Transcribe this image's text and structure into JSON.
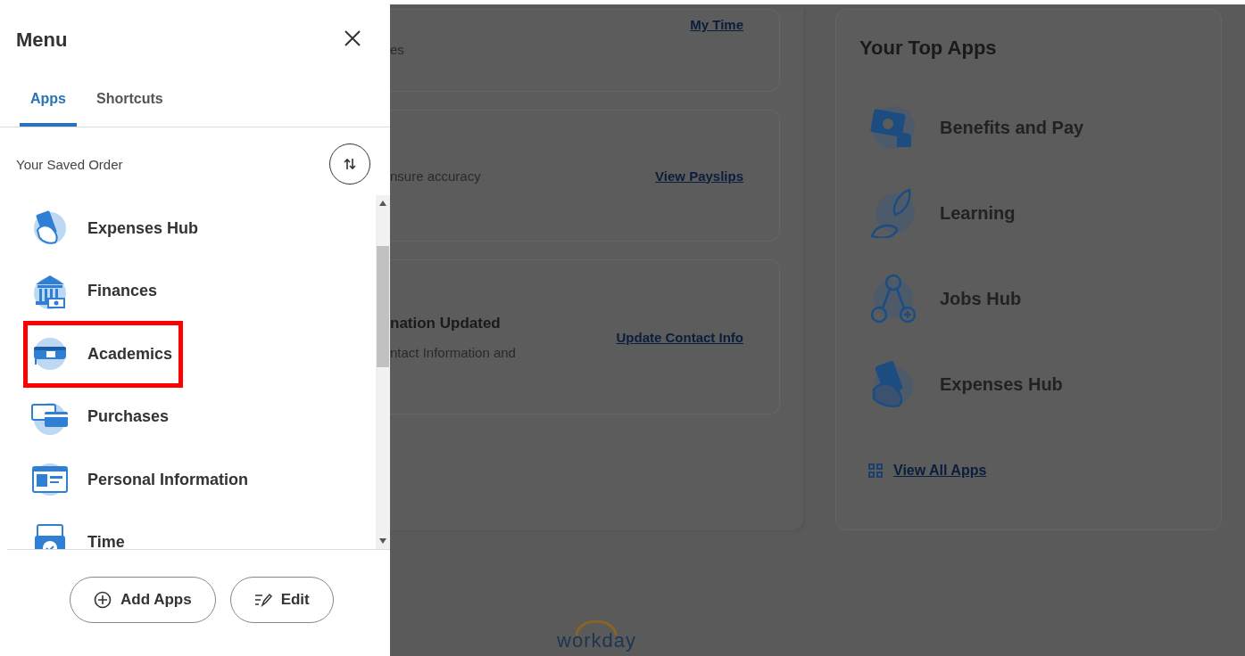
{
  "drawer": {
    "title": "Menu",
    "tabs": [
      {
        "label": "Apps",
        "selected": true
      },
      {
        "label": "Shortcuts",
        "selected": false
      }
    ],
    "order_label": "Your Saved Order",
    "apps": [
      {
        "label": "Expenses Hub",
        "kind": "hand",
        "highlighted": false
      },
      {
        "label": "Finances",
        "kind": "bank",
        "highlighted": false
      },
      {
        "label": "Academics",
        "kind": "cap",
        "highlighted": true
      },
      {
        "label": "Purchases",
        "kind": "cards",
        "highlighted": false
      },
      {
        "label": "Personal Information",
        "kind": "id",
        "highlighted": false
      },
      {
        "label": "Time",
        "kind": "clock",
        "highlighted": false
      }
    ],
    "buttons": [
      {
        "label": "Add Apps",
        "kind": "add"
      },
      {
        "label": "Edit",
        "kind": "edit"
      }
    ]
  },
  "cards": [
    {
      "text": "es",
      "link": "My Time"
    },
    {
      "text": "nsure accuracy",
      "link": "View Payslips"
    },
    {
      "title": "nation Updated",
      "text": "ntact Information and",
      "link": "Update Contact Info"
    }
  ],
  "top_apps": {
    "title": "Your Top Apps",
    "apps": [
      {
        "label": "Benefits and Pay",
        "kind": "money"
      },
      {
        "label": "Learning",
        "kind": "leaf"
      },
      {
        "label": "Jobs Hub",
        "kind": "people"
      },
      {
        "label": "Expenses Hub",
        "kind": "hand"
      }
    ],
    "link": "View All Apps"
  },
  "footer": {
    "logo": "workday"
  }
}
